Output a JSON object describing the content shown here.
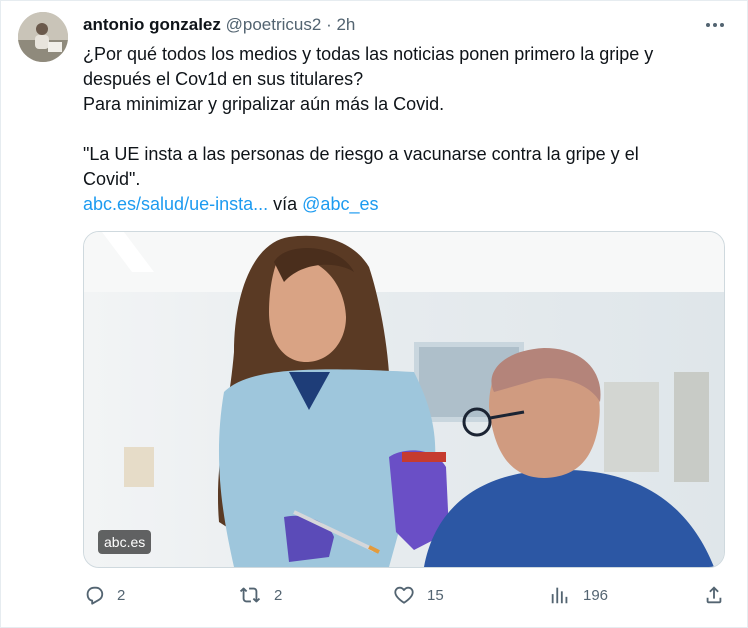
{
  "tweet": {
    "author_name": "antonio gonzalez",
    "handle": "@poetricus2",
    "separator": "·",
    "time": "2h",
    "lines": [
      "¿Por qué todos los medios y todas las noticias ponen primero la gripe y",
      "después el Cov1d en sus titulares?",
      "Para minimizar  y gripalizar aún más la Covid."
    ],
    "quote_lines": [
      "\"La UE insta a las personas de riesgo a vacunarse contra la gripe y el",
      "Covid\"."
    ],
    "link_text": "abc.es/salud/ue-insta...",
    "via_text": "vía",
    "via_handle": "@abc_es",
    "media_source": "abc.es"
  },
  "actions": {
    "replies": "2",
    "retweets": "2",
    "likes": "15",
    "views": "196"
  },
  "icons": {
    "more": "more-horizontal-icon",
    "reply": "reply-icon",
    "retweet": "retweet-icon",
    "like": "heart-icon",
    "views": "views-chart-icon",
    "share": "share-icon"
  },
  "colors": {
    "link": "#1d9bf0",
    "secondary_text": "#536471",
    "primary_text": "#0f1419"
  }
}
